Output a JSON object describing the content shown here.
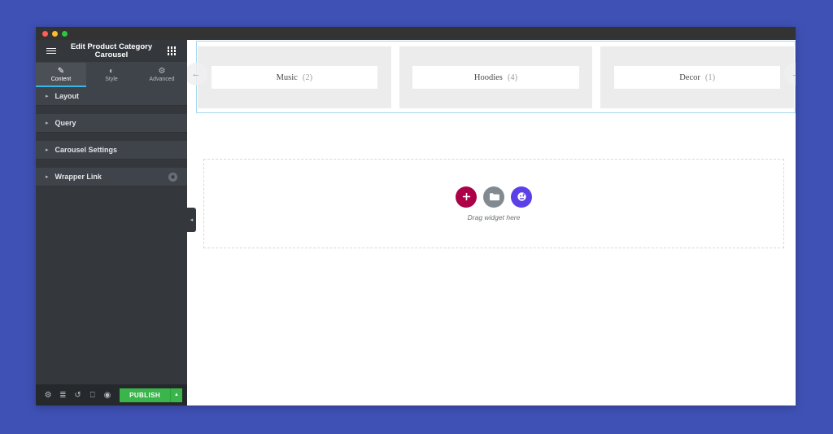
{
  "window": {
    "traffic_lights": [
      "close",
      "minimize",
      "maximize"
    ]
  },
  "panel": {
    "menu_icon": "hamburger-menu-icon",
    "title": "Edit Product Category Carousel",
    "apps_icon": "grid-apps-icon",
    "tabs": [
      {
        "label": "Content",
        "icon": "pencil-icon",
        "glyph": "✎",
        "active": true
      },
      {
        "label": "Style",
        "icon": "contrast-circle-icon",
        "glyph": "◐",
        "active": false
      },
      {
        "label": "Advanced",
        "icon": "gear-icon",
        "glyph": "⚙",
        "active": false
      }
    ],
    "sections": [
      {
        "label": "Layout",
        "arrow": "▸",
        "badge": null
      },
      {
        "label": "Query",
        "arrow": "▸",
        "badge": null
      },
      {
        "label": "Carousel Settings",
        "arrow": "▸",
        "badge": null
      },
      {
        "label": "Wrapper Link",
        "arrow": "▸",
        "badge": "◉"
      }
    ],
    "footer": {
      "icons": [
        {
          "name": "settings-gear-icon",
          "glyph": "⚙"
        },
        {
          "name": "navigator-layers-icon",
          "glyph": "≣"
        },
        {
          "name": "history-revisions-icon",
          "glyph": "↺"
        },
        {
          "name": "responsive-mode-icon",
          "glyph": "⎕"
        },
        {
          "name": "preview-eye-icon",
          "glyph": "◉"
        }
      ],
      "publish_label": "PUBLISH",
      "publish_caret": "▲",
      "publish_color": "#39b54a"
    }
  },
  "canvas": {
    "collapse_handle_glyph": "◂",
    "carousel": {
      "prev_arrow": "←",
      "next_arrow": "→",
      "items": [
        {
          "name": "Music",
          "count": "(2)"
        },
        {
          "name": "Hoodies",
          "count": "(4)"
        },
        {
          "name": "Decor",
          "count": "(1)"
        }
      ]
    },
    "drop_area": {
      "add_glyph": "+",
      "folder_glyph": "▰",
      "ai_glyph": "●",
      "label": "Drag widget here"
    }
  },
  "colors": {
    "desktop_background": "#3f51b5",
    "panel_background": "#34383c",
    "accent_cyan": "#39b5e6",
    "publish_green": "#39b54a",
    "add_button": "#ac0048",
    "folder_button": "#818a91",
    "ai_button": "#5b40e8",
    "selection_outline": "#a4d8ef"
  }
}
